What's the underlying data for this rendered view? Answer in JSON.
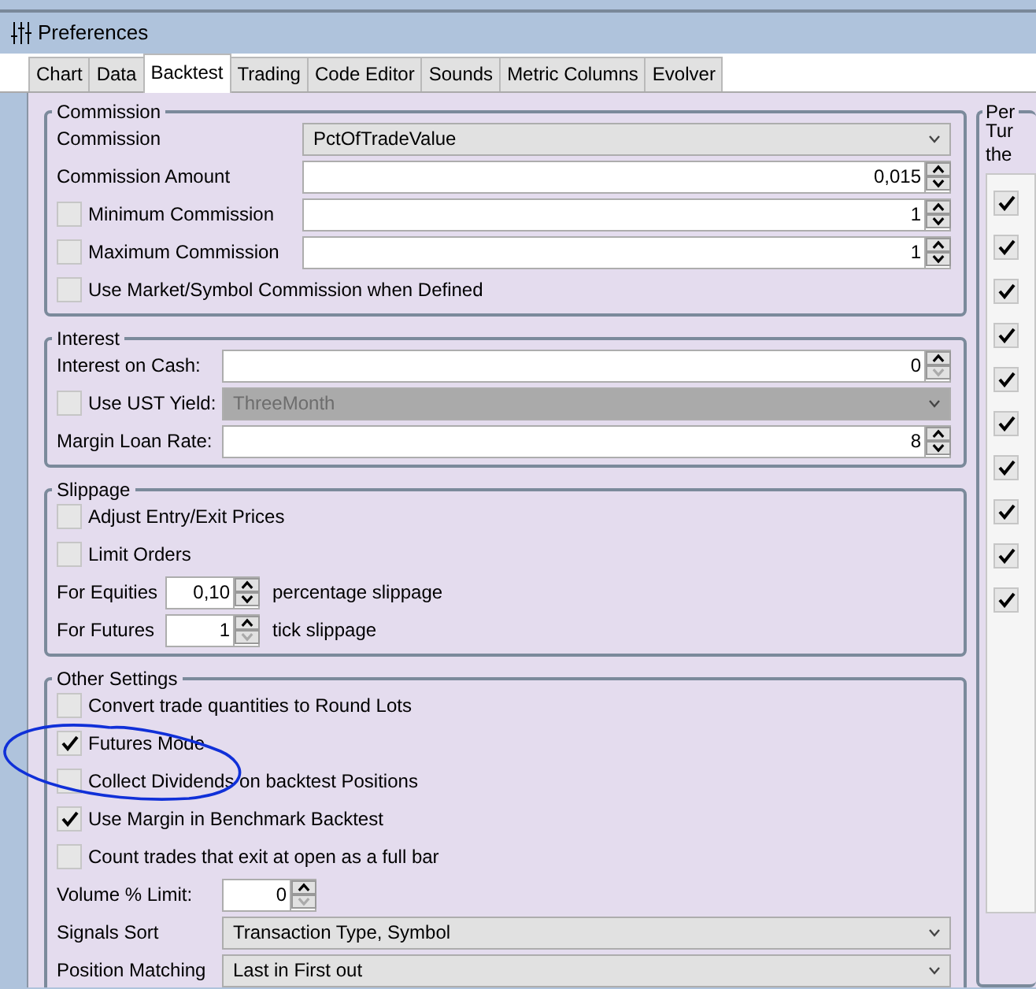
{
  "window": {
    "title": "Preferences"
  },
  "tabs": [
    {
      "label": "Chart",
      "selected": false
    },
    {
      "label": "Data",
      "selected": false
    },
    {
      "label": "Backtest",
      "selected": true
    },
    {
      "label": "Trading",
      "selected": false
    },
    {
      "label": "Code Editor",
      "selected": false
    },
    {
      "label": "Sounds",
      "selected": false
    },
    {
      "label": "Metric Columns",
      "selected": false
    },
    {
      "label": "Evolver",
      "selected": false
    }
  ],
  "groups": [
    {
      "title": "Commission",
      "rows": [
        {
          "kind": "select",
          "label": "Commission",
          "value": "PctOfTradeValue",
          "disabled": false
        },
        {
          "kind": "spin",
          "label": "Commission Amount",
          "value": "0,015",
          "at_min": false
        },
        {
          "kind": "check-spin",
          "label": "Minimum Commission",
          "checked": false,
          "value": "1",
          "at_min": false
        },
        {
          "kind": "check-spin",
          "label": "Maximum Commission",
          "checked": false,
          "value": "1",
          "at_min": false
        },
        {
          "kind": "check",
          "label": "Use Market/Symbol Commission when Defined",
          "checked": false
        }
      ]
    },
    {
      "title": "Interest",
      "rows": [
        {
          "kind": "spin",
          "label": "Interest on Cash:",
          "value": "0",
          "at_min": true
        },
        {
          "kind": "check-select",
          "label": "Use UST Yield:",
          "checked": false,
          "value": "ThreeMonth",
          "disabled": true
        },
        {
          "kind": "spin",
          "label": "Margin Loan Rate:",
          "value": "8",
          "at_min": false
        }
      ]
    },
    {
      "title": "Slippage",
      "rows": [
        {
          "kind": "check",
          "label": "Adjust Entry/Exit Prices",
          "checked": false
        },
        {
          "kind": "check",
          "label": "Limit Orders",
          "checked": false
        },
        {
          "kind": "small-spin",
          "label": "For Equities",
          "value": "0,10",
          "suffix": "percentage slippage",
          "at_min": false
        },
        {
          "kind": "small-spin",
          "label": "For Futures",
          "value": "1",
          "suffix": "tick slippage",
          "at_min": true
        }
      ]
    },
    {
      "title": "Other Settings",
      "rows": [
        {
          "kind": "check",
          "label": "Convert trade quantities to Round Lots",
          "checked": false
        },
        {
          "kind": "check",
          "label": "Futures Mode",
          "checked": true
        },
        {
          "kind": "check",
          "label": "Collect Dividends on backtest Positions",
          "checked": false
        },
        {
          "kind": "check",
          "label": "Use Margin in Benchmark Backtest",
          "checked": true
        },
        {
          "kind": "check",
          "label": "Count trades that exit at open as a full bar",
          "checked": false
        },
        {
          "kind": "small-spin",
          "label": "Volume % Limit:",
          "value": "0",
          "at_min": true
        },
        {
          "kind": "select",
          "label": "Signals Sort",
          "value": "Transaction Type, Symbol",
          "disabled": false
        },
        {
          "kind": "select",
          "label": "Position Matching",
          "value": "Last in First out",
          "disabled": false
        }
      ]
    }
  ],
  "side_panel": {
    "title": "Per",
    "text_lines": [
      "Tur",
      "the"
    ],
    "items": [
      {
        "checked": true
      },
      {
        "checked": true
      },
      {
        "checked": true
      },
      {
        "checked": true
      },
      {
        "checked": true
      },
      {
        "checked": true
      },
      {
        "checked": true
      },
      {
        "checked": true
      },
      {
        "checked": true
      },
      {
        "checked": true
      }
    ]
  }
}
